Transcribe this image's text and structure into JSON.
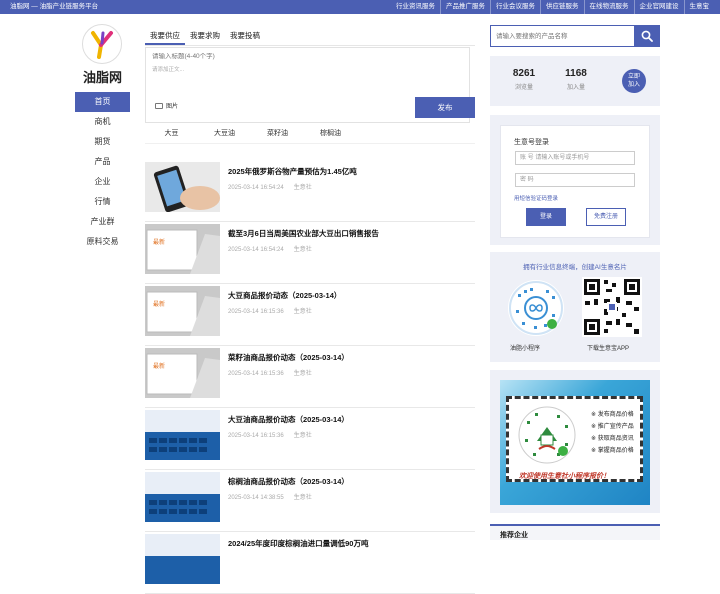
{
  "topbar": {
    "site": "油脂网 — 油脂产业链服务平台",
    "links": [
      "行业资讯服务",
      "产品推广服务",
      "行业会议服务",
      "供应链服务",
      "在线物流服务",
      "企业官网建设",
      "生意宝"
    ]
  },
  "brand": {
    "name": "油脂网"
  },
  "nav": [
    "首页",
    "商机",
    "期货",
    "产品",
    "企业",
    "行情",
    "产业群",
    "原料交易"
  ],
  "post": {
    "tabs": [
      "我要供应",
      "我要求购",
      "我要投稿"
    ],
    "title_placeholder": "请输入标题(4-40个字)",
    "body_placeholder": "请添加正文...",
    "image_label": "图片",
    "publish_label": "发布"
  },
  "categories": [
    "大豆",
    "大豆油",
    "菜籽油",
    "棕榈油"
  ],
  "news": [
    {
      "title": "2025年俄罗斯谷物产量预估为1.45亿吨",
      "date": "2025-03-14 16:54:24",
      "source": "生意社",
      "thumb": "phone"
    },
    {
      "title": "截至3月6日当周美国农业部大豆出口销售报告",
      "date": "2025-03-14 16:54:24",
      "source": "生意社",
      "thumb": "card"
    },
    {
      "title": "大豆商品报价动态（2025-03-14）",
      "date": "2025-03-14 16:15:36",
      "source": "生意社",
      "thumb": "card"
    },
    {
      "title": "菜籽油商品报价动态（2025-03-14）",
      "date": "2025-03-14 16:15:36",
      "source": "生意社",
      "thumb": "card"
    },
    {
      "title": "大豆油商品报价动态（2025-03-14）",
      "date": "2025-03-14 16:15:36",
      "source": "生意社",
      "thumb": "keyboard"
    },
    {
      "title": "棕榈油商品报价动态（2025-03-14）",
      "date": "2025-03-14 14:38:55",
      "source": "生意社",
      "thumb": "keyboard"
    },
    {
      "title": "2024/25年度印度棕榈油进口量调低90万吨",
      "date": "",
      "source": "",
      "thumb": "keyboard"
    }
  ],
  "thumb_badge": "最新",
  "search": {
    "placeholder": "请输入要搜索的产品名称",
    "icon": "search-icon"
  },
  "stats": {
    "views": "8261",
    "views_label": "浏览量",
    "joined": "1168",
    "joined_label": "加入量",
    "join_line1": "立即",
    "join_line2": "加入"
  },
  "login": {
    "title": "生意号登录",
    "account_placeholder": "账 号   请输入账号或手机号",
    "password_placeholder": "密 码",
    "sms_link": "用短信验证码登录",
    "login_label": "登录",
    "register_label": "免费注册"
  },
  "promo": {
    "title": "拥有行业信息终端，创建AI生意名片",
    "mini_label": "油脂小程序",
    "app_label": "下载生意宝APP"
  },
  "banner": {
    "items": [
      "发布商品价格",
      "推广宣传产品",
      "获取商品资讯",
      "掌握商品价格"
    ],
    "footer": "欢迎使用生意社小程序报价！"
  },
  "recommend": {
    "title": "推荐企业"
  },
  "colors": {
    "accent": "#4b5fb3",
    "panel_bg": "#eef0f7"
  }
}
